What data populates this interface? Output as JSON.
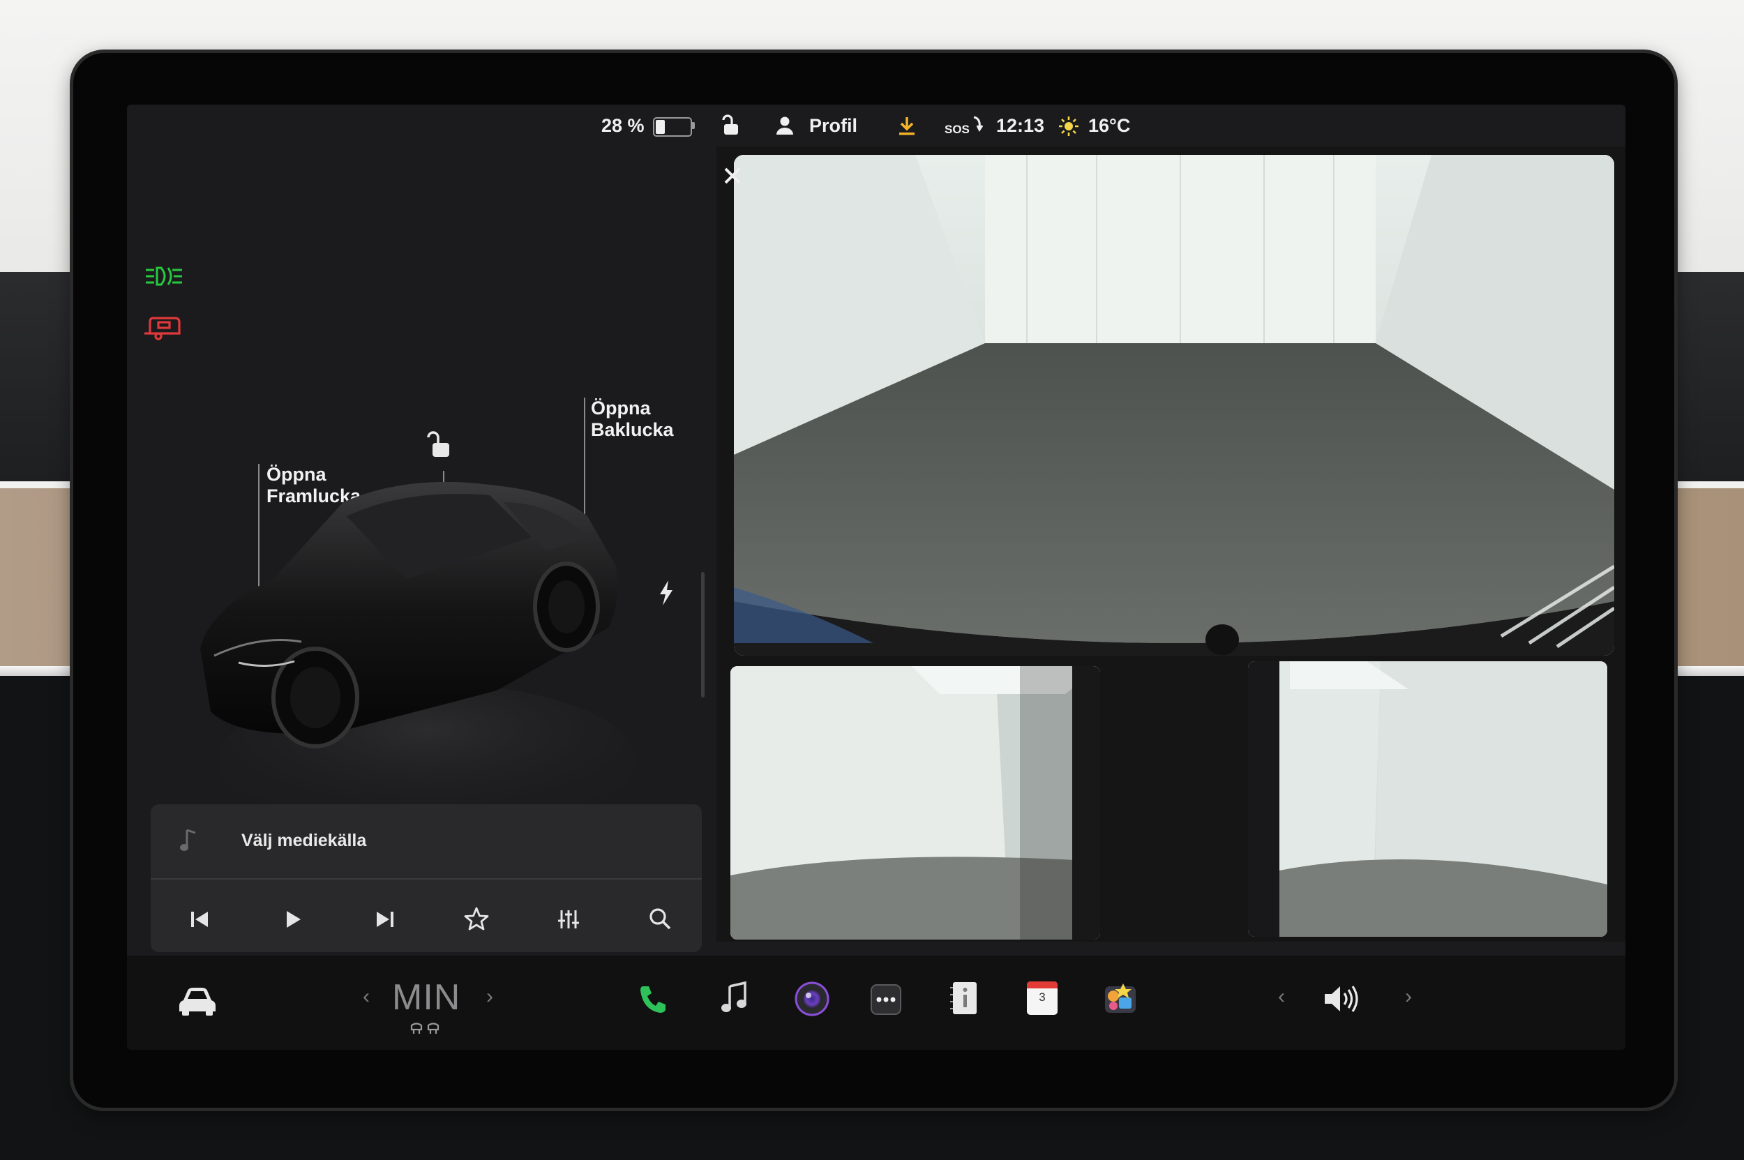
{
  "status_bar": {
    "battery_percent_label": "28 %",
    "battery_level": 0.28,
    "profile_label": "Profil",
    "sos_label": "SOS",
    "time": "12:13",
    "temperature": "16°C"
  },
  "car_panel": {
    "frunk_label_line1": "Öppna",
    "frunk_label_line2": "Framlucka",
    "trunk_label_line1": "Öppna",
    "trunk_label_line2": "Baklucka"
  },
  "media": {
    "source_label": "Välj mediekälla"
  },
  "dock": {
    "fan_level_label": "MIN",
    "calendar_day": "3"
  },
  "colors": {
    "headlight_indicator": "#27c93f",
    "trailer_indicator": "#e0393b",
    "phone_icon": "#2fc25b",
    "download_icon": "#f3b229",
    "sun_icon": "#f5d648"
  }
}
